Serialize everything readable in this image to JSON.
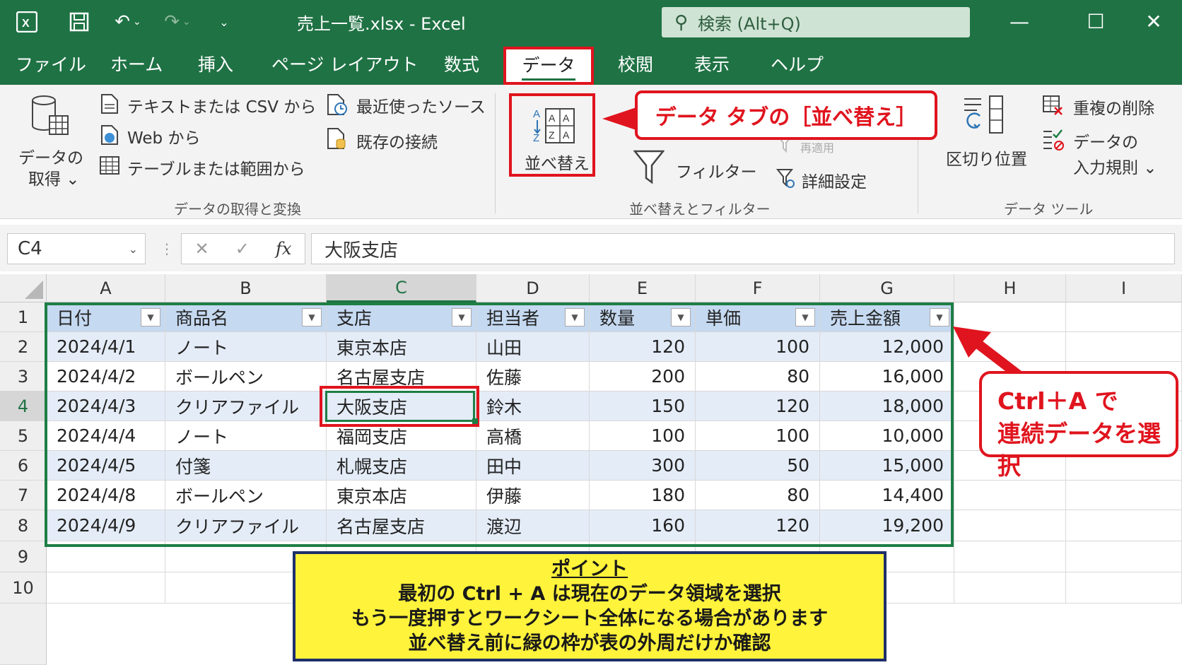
{
  "titlebar": {
    "filename": "売上一覧.xlsx  -  Excel",
    "search_placeholder": "検索 (Alt+Q)"
  },
  "menu": [
    "ファイル",
    "ホーム",
    "挿入",
    "ページ レイアウト",
    "数式",
    "データ",
    "校閲",
    "表示",
    "ヘルプ"
  ],
  "ribbon": {
    "get_data": [
      "データの",
      "取得 ⌄"
    ],
    "text_csv": "テキストまたは CSV から",
    "web": "Web から",
    "table_range": "テーブルまたは範囲から",
    "recent_sources": "最近使ったソース",
    "existing_connections": "既存の接続",
    "group1_label": "データの取得と変換",
    "sort": "並べ替え",
    "filter": "フィルター",
    "reapply": "再適用",
    "advanced": "詳細設定",
    "group2_label": "並べ替えとフィルター",
    "text_to_columns": "区切り位置",
    "remove_duplicates": "重複の削除",
    "data_validation": [
      "データの",
      "入力規則 ⌄"
    ],
    "group3_label": "データ ツール"
  },
  "callout_sort": "データ タブの［並べ替え］",
  "formula_bar": {
    "name_box": "C4",
    "formula": "大阪支店",
    "cancel": "✕",
    "enter": "✓",
    "fx": "fx"
  },
  "columns": [
    "A",
    "B",
    "C",
    "D",
    "E",
    "F",
    "G",
    "H",
    "I"
  ],
  "rows": [
    "1",
    "2",
    "3",
    "4",
    "5",
    "6",
    "7",
    "8",
    "9",
    "10"
  ],
  "table": {
    "headers": [
      "日付",
      "商品名",
      "支店",
      "担当者",
      "数量",
      "単価",
      "売上金額"
    ],
    "rows": [
      [
        "2024/4/1",
        "ノート",
        "東京本店",
        "山田",
        "120",
        "100",
        "12,000"
      ],
      [
        "2024/4/2",
        "ボールペン",
        "名古屋支店",
        "佐藤",
        "200",
        "80",
        "16,000"
      ],
      [
        "2024/4/3",
        "クリアファイル",
        "大阪支店",
        "鈴木",
        "150",
        "120",
        "18,000"
      ],
      [
        "2024/4/4",
        "ノート",
        "福岡支店",
        "高橋",
        "100",
        "100",
        "10,000"
      ],
      [
        "2024/4/5",
        "付箋",
        "札幌支店",
        "田中",
        "300",
        "50",
        "15,000"
      ],
      [
        "2024/4/8",
        "ボールペン",
        "東京本店",
        "伊藤",
        "180",
        "80",
        "14,400"
      ],
      [
        "2024/4/9",
        "クリアファイル",
        "名古屋支店",
        "渡辺",
        "160",
        "120",
        "19,200"
      ]
    ]
  },
  "callout_select": [
    "Ctrl＋A で",
    "連続データを選択"
  ],
  "point": {
    "title": "ポイント",
    "lines": [
      "最初の Ctrl + A は現在のデータ領域を選択",
      "もう一度押すとワークシート全体になる場合があります",
      "並べ替え前に緑の枠が表の外周だけか確認"
    ]
  },
  "colors": {
    "excel_green": "#1f7244",
    "highlight_red": "#e0141e",
    "note_yellow": "#fff33b"
  }
}
